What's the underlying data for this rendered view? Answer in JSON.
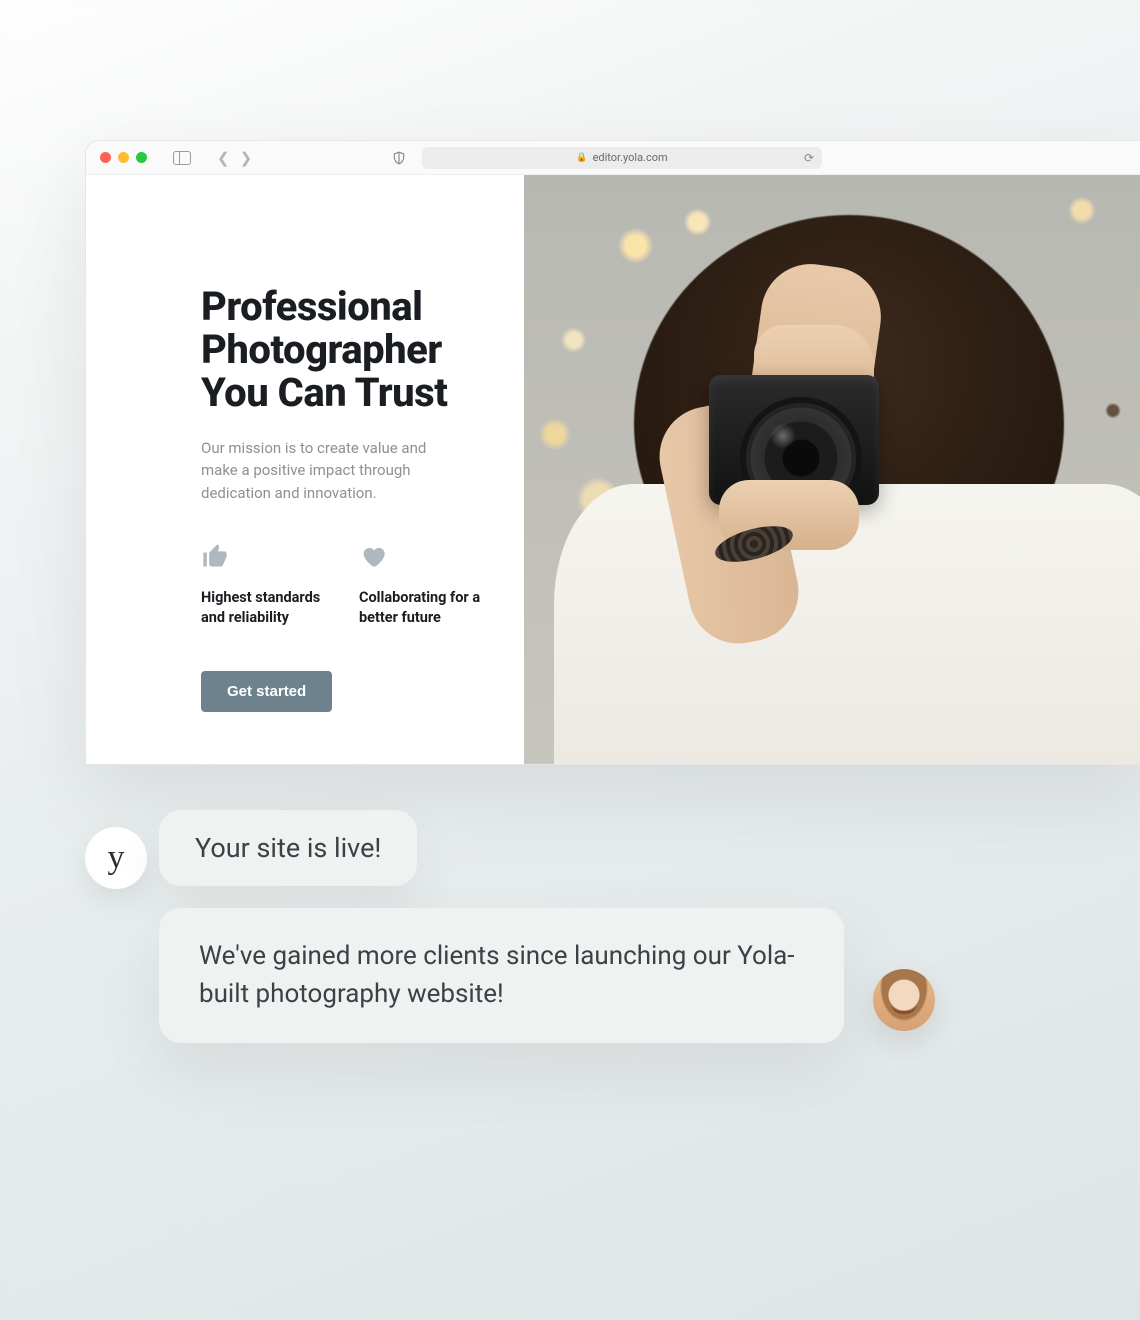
{
  "browser": {
    "url": "editor.yola.com"
  },
  "hero": {
    "title_line1": "Professional",
    "title_line2": "Photographer",
    "title_line3": "You Can Trust",
    "subtitle": "Our mission is to create value and make a positive impact through dedication and innovation.",
    "features": [
      {
        "label": "Highest standards and reliability"
      },
      {
        "label": "Collaborating for a better future"
      }
    ],
    "cta_label": "Get started"
  },
  "chat": {
    "brand_initial": "y",
    "message_1": "Your site is live!",
    "message_2": "We've gained more clients since launching our Yola-built photography website!"
  }
}
